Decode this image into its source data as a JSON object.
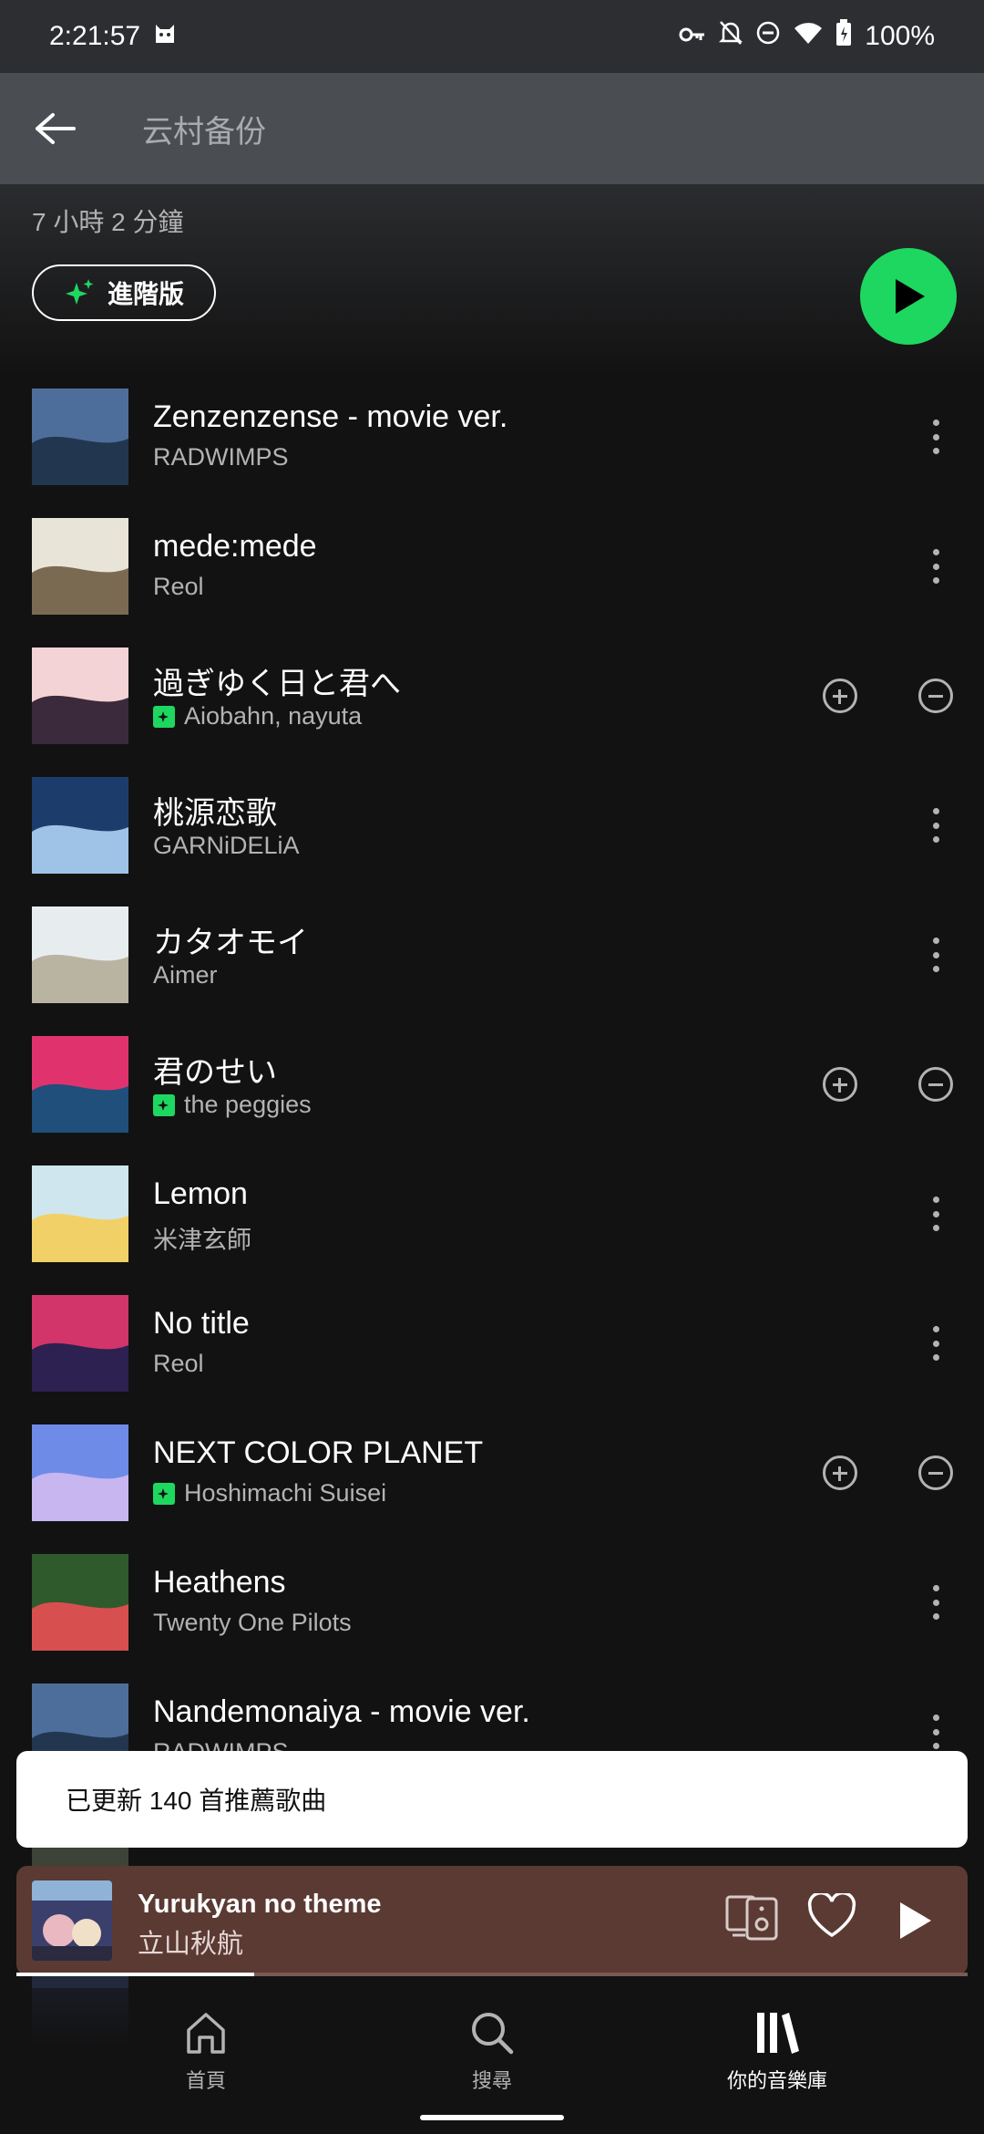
{
  "status_bar": {
    "time": "2:21:57",
    "battery": "100%"
  },
  "header": {
    "title": "云村备份"
  },
  "playlist": {
    "duration": "7 小時 2 分鐘",
    "premium_label": "進階版"
  },
  "tracks": [
    {
      "title": "Zenzenzense - movie ver.",
      "artist": "RADWIMPS",
      "recommended": false,
      "art_colors": [
        "#4d6e9a",
        "#22374f"
      ]
    },
    {
      "title": "mede:mede",
      "artist": "Reol",
      "recommended": false,
      "art_colors": [
        "#e9e4d8",
        "#7b6a52"
      ]
    },
    {
      "title": "過ぎゆく日と君へ",
      "artist": "Aiobahn, nayuta",
      "recommended": true,
      "art_colors": [
        "#f3d3d6",
        "#3a2a3c"
      ]
    },
    {
      "title": "桃源恋歌",
      "artist": "GARNiDELiA",
      "recommended": false,
      "art_colors": [
        "#1c3d6b",
        "#9ec3e6"
      ]
    },
    {
      "title": "カタオモイ",
      "artist": "Aimer",
      "recommended": false,
      "art_colors": [
        "#e7ecef",
        "#b9b3a2"
      ]
    },
    {
      "title": "君のせい",
      "artist": "the peggies",
      "recommended": true,
      "art_colors": [
        "#e0336e",
        "#1f4f7a"
      ]
    },
    {
      "title": "Lemon",
      "artist": "米津玄師",
      "recommended": false,
      "art_colors": [
        "#cfe6ee",
        "#f1d067"
      ]
    },
    {
      "title": "No title",
      "artist": "Reol",
      "recommended": false,
      "art_colors": [
        "#d1356a",
        "#2c2150"
      ]
    },
    {
      "title": "NEXT COLOR PLANET",
      "artist": "Hoshimachi Suisei",
      "recommended": true,
      "art_colors": [
        "#6f8be8",
        "#c8b6f0"
      ]
    },
    {
      "title": "Heathens",
      "artist": "Twenty One Pilots",
      "recommended": false,
      "art_colors": [
        "#2f5a2c",
        "#d84f4f"
      ]
    },
    {
      "title": "Nandemonaiya - movie ver.",
      "artist": "RADWIMPS",
      "recommended": false,
      "art_colors": [
        "#4d6e9a",
        "#22374f"
      ]
    }
  ],
  "toast": {
    "message": "已更新 140 首推薦歌曲"
  },
  "now_playing": {
    "title": "Yurukyan no theme",
    "artist": "立山秋航",
    "progress": 0.25
  },
  "nav": {
    "home": "首頁",
    "search": "搜尋",
    "library": "你的音樂庫"
  },
  "colors": {
    "accent": "#1ed760",
    "now_playing_bg": "#5b3a34"
  }
}
